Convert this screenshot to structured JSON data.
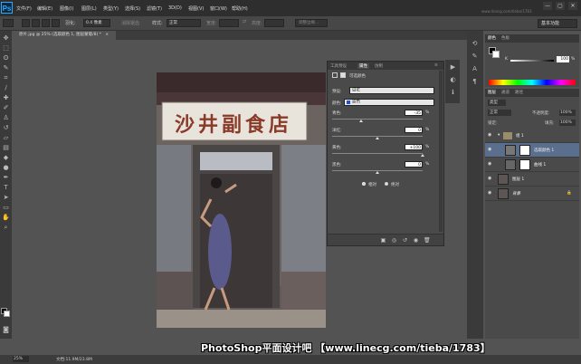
{
  "app": {
    "logo": "Ps"
  },
  "menu": [
    "文件(F)",
    "编辑(E)",
    "图像(I)",
    "图层(L)",
    "类型(Y)",
    "选择(S)",
    "滤镜(T)",
    "3D(D)",
    "视图(V)",
    "窗口(W)",
    "帮助(H)"
  ],
  "window_controls": [
    "—",
    "▢",
    "✕"
  ],
  "options_bar": {
    "feather_label": "羽化:",
    "feather_value": "0.4 像素",
    "antialias_label": "消除锯齿",
    "style_label": "样式:",
    "style_value": "正常",
    "width_label": "宽度:",
    "height_label": "高度:",
    "refine_edge": "调整边缘...",
    "workspace": "基本功能"
  },
  "document_tab": {
    "title": "原片.jpg @ 25% (选取颜色 1, 图层蒙版/8) *",
    "close": "×"
  },
  "photo": {
    "sign_text": "沙井副食店"
  },
  "properties_panel": {
    "tabs": [
      "工具预设",
      "属性",
      "仿制"
    ],
    "active_tab": "属性",
    "adjustment_name": "可选颜色",
    "preset_label": "预设:",
    "preset_value": "自定",
    "colors_label": "颜色:",
    "colors_value": "蓝色",
    "color_swatch": "#1f4fd6",
    "sliders": [
      {
        "label": "青色:",
        "value": "-35",
        "unit": "%",
        "pos": 0.32
      },
      {
        "label": "洋红:",
        "value": "0",
        "unit": "%",
        "pos": 0.5
      },
      {
        "label": "黄色:",
        "value": "+100",
        "unit": "%",
        "pos": 1.0
      },
      {
        "label": "黑色:",
        "value": "0",
        "unit": "%",
        "pos": 0.5
      }
    ],
    "method_relative": "相对",
    "method_absolute": "绝对",
    "method_selected": "相对"
  },
  "color_panel": {
    "tabs": [
      "颜色",
      "色板"
    ],
    "k_label": "K",
    "k_value": "100",
    "k_unit": "%"
  },
  "layers_panel": {
    "tabs": [
      "图层",
      "通道",
      "路径"
    ],
    "filter_label": "类型",
    "blend_mode": "正常",
    "opacity_label": "不透明度:",
    "opacity_value": "100%",
    "lock_label": "锁定:",
    "fill_label": "填充:",
    "fill_value": "100%",
    "layers": [
      {
        "name": "组 1",
        "kind": "group",
        "selected": false
      },
      {
        "name": "选取颜色 1",
        "kind": "adjustment",
        "selected": true
      },
      {
        "name": "曲线 1",
        "kind": "adjustment",
        "selected": false
      },
      {
        "name": "图层 1",
        "kind": "pixel",
        "selected": false
      },
      {
        "name": "背景",
        "kind": "background",
        "selected": false
      }
    ]
  },
  "status_bar": {
    "zoom": "25%",
    "doc_info": "文档:11.9M/23.8M"
  },
  "watermark": "PhotoShop平面设计吧 【www.linecg.com/tieba/1783】",
  "faint_url": "www.linecg.com/tieba/1783"
}
